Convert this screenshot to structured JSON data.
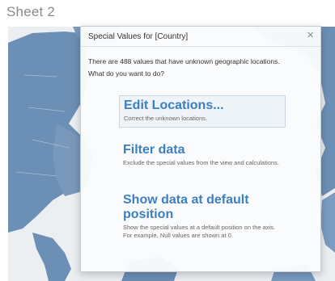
{
  "sheet": {
    "title": "Sheet 2"
  },
  "dialog": {
    "title": "Special Values for [Country]",
    "close_glyph": "×",
    "message_line1": "There are 488 values that have unknown geographic locations.",
    "message_line2": "What do you want to do?",
    "options": [
      {
        "label": "Edit Locations...",
        "description": "Correct the unknown locations."
      },
      {
        "label": "Filter data",
        "description": "Exclude the special values from the view and calculations."
      },
      {
        "label": "Show data at default position",
        "description": "Show the special values at a default position on the axis. For example, Null values are shown at 0."
      }
    ]
  },
  "colors": {
    "map_land": "#6c8fb5",
    "map_water": "#eceff2",
    "accent": "#3c7fc0"
  }
}
